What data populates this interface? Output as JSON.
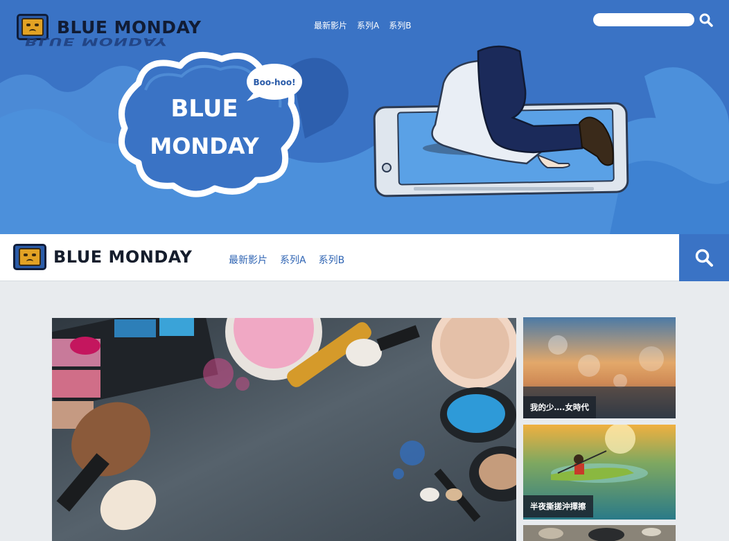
{
  "hero": {
    "logo_text": "BLUE MONDAY",
    "logo_reflection": "BLUE MONDAY",
    "nav": [
      "最新影片",
      "系列A",
      "系列B"
    ],
    "search_placeholder": "",
    "cloud_text_line1": "BLUE",
    "cloud_text_line2": "MONDAY",
    "speech_bubble": "Boo-hoo!"
  },
  "header": {
    "logo_text": "BLUE MONDAY",
    "nav": [
      "最新影片",
      "系列A",
      "系列B"
    ]
  },
  "cards": [
    {
      "caption": "我的少….女時代"
    },
    {
      "caption": "半夜撕搓沖擇擦"
    },
    {
      "caption": ""
    }
  ],
  "colors": {
    "brand_blue": "#3a73c5",
    "page_bg": "#e8ebee",
    "nav_link": "#2f64b3",
    "caption_bg": "#1c232d"
  },
  "icons": {
    "hero_search": "search-icon",
    "header_search": "search-icon",
    "logo": "grumpy-face-icon"
  }
}
